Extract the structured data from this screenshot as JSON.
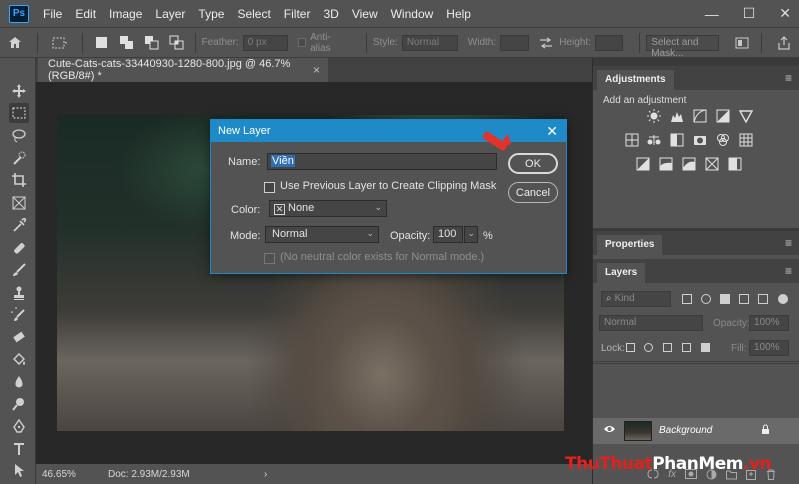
{
  "app": {
    "logo": "Ps"
  },
  "menu": [
    "File",
    "Edit",
    "Image",
    "Layer",
    "Type",
    "Select",
    "Filter",
    "3D",
    "View",
    "Window",
    "Help"
  ],
  "window_controls": [
    "—",
    "☐",
    "✕"
  ],
  "options": {
    "feather_label": "Feather:",
    "feather_value": "0 px",
    "antialias_label": "Anti-alias",
    "style_label": "Style:",
    "style_value": "Normal",
    "width_label": "Width:",
    "height_label": "Height:",
    "select_mask_label": "Select and Mask..."
  },
  "document": {
    "tab_title": "Cute-Cats-cats-33440930-1280-800.jpg @ 46.7% (RGB/8#) *",
    "tab_close": "×",
    "zoom": "46.65%",
    "doc_info": "Doc: 2.93M/2.93M",
    "status_chevron": "›"
  },
  "panels": {
    "adjustments": {
      "title": "Adjustments",
      "subtitle": "Add an adjustment",
      "menu_icon": "≡"
    },
    "properties": {
      "title": "Properties",
      "menu_icon": "≡"
    },
    "layers": {
      "title": "Layers",
      "menu_icon": "≡",
      "filter_kind": "Kind",
      "blend_mode": "Normal",
      "opacity_label": "Opacity:",
      "opacity_value": "100%",
      "lock_label": "Lock:",
      "fill_label": "Fill:",
      "fill_value": "100%",
      "layer_name": "Background",
      "lock_icon": "🔒",
      "eye_icon": "👁"
    }
  },
  "dialog": {
    "title": "New Layer",
    "close": "✕",
    "name_label": "Name:",
    "name_value": "Viền",
    "clipping_label": "Use Previous Layer to Create Clipping Mask",
    "color_label": "Color:",
    "color_value": "None",
    "mode_label": "Mode:",
    "mode_value": "Normal",
    "opacity_label": "Opacity:",
    "opacity_value": "100",
    "percent": "%",
    "neutral_label": "(No neutral color exists for Normal mode.)",
    "ok_label": "OK",
    "cancel_label": "Cancel",
    "chevron": "⌄",
    "color_swatch_mark": "✕"
  },
  "watermark": {
    "part1": "Thu",
    "part2": "Thuat",
    "part3": "PhanMem",
    "part4": ".vn"
  },
  "colors": {
    "accent": "#1f8ac8",
    "arrow": "#e2322a",
    "panel_bg": "#535353",
    "dark_bg": "#282828"
  }
}
